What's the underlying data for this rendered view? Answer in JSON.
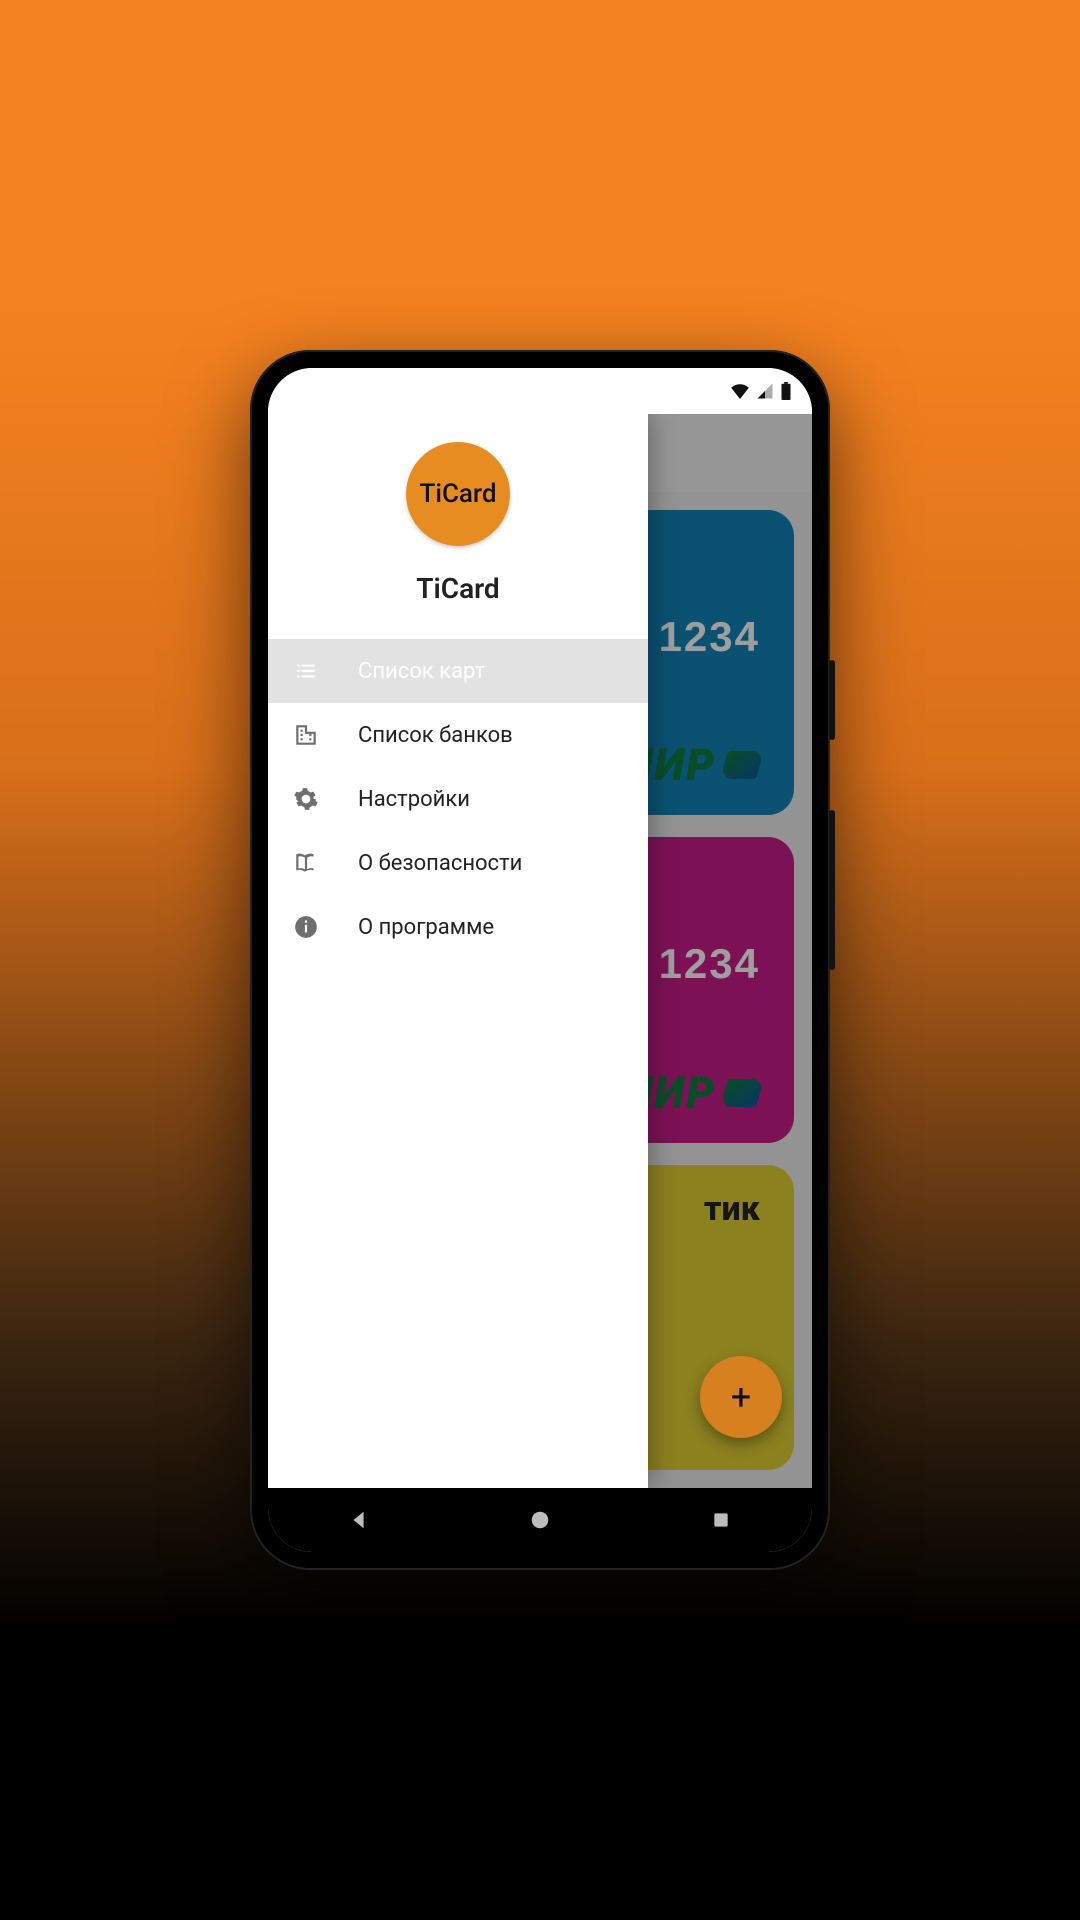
{
  "colors": {
    "accent": "#e78c21",
    "card_blue": "#1183b8",
    "card_pink": "#c81c8c",
    "card_yellow": "#e3d133",
    "mir_green": "#0f7c3f"
  },
  "app": {
    "logo_text": "TiCard",
    "title": "TiCard"
  },
  "drawer": {
    "items": [
      {
        "icon": "list-icon",
        "label": "Список карт",
        "active": true
      },
      {
        "icon": "bank-icon",
        "label": "Список банков",
        "active": false
      },
      {
        "icon": "gear-icon",
        "label": "Настройки",
        "active": false
      },
      {
        "icon": "book-icon",
        "label": "О безопасности",
        "active": false
      },
      {
        "icon": "info-icon",
        "label": "О программе",
        "active": false
      }
    ]
  },
  "cards": [
    {
      "number_visible": "1234",
      "brand": "МИР",
      "color": "blue"
    },
    {
      "number_visible": "1234",
      "brand": "МИР",
      "color": "pink"
    },
    {
      "label_visible": "тик",
      "color": "yellow"
    }
  ],
  "fab": {
    "label": "+"
  }
}
